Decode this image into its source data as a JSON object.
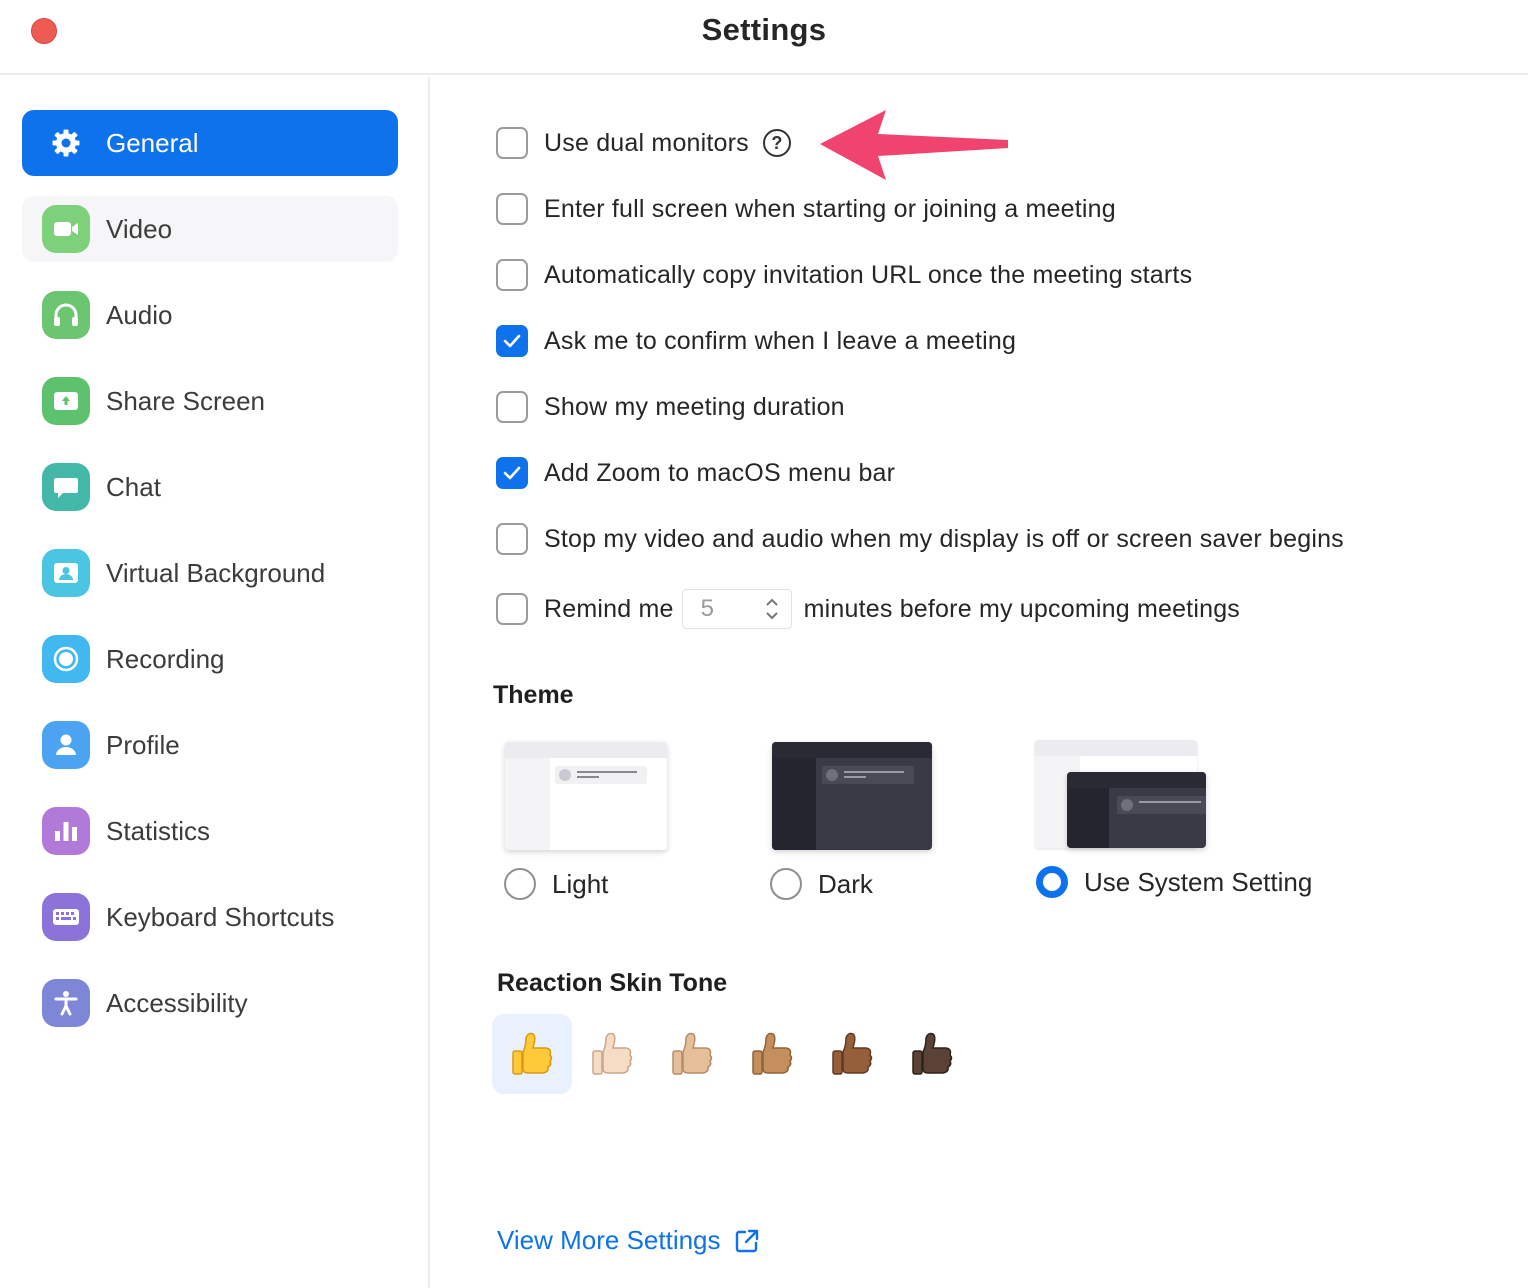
{
  "window": {
    "title": "Settings"
  },
  "sidebar": {
    "items": [
      {
        "label": "General",
        "icon": "gear-icon",
        "color": "#0e72ed",
        "state": "active"
      },
      {
        "label": "Video",
        "icon": "video-camera-icon",
        "color": "#7ed07a",
        "state": "hover"
      },
      {
        "label": "Audio",
        "icon": "headphones-icon",
        "color": "#6cc570",
        "state": ""
      },
      {
        "label": "Share Screen",
        "icon": "share-screen-icon",
        "color": "#5cc26e",
        "state": ""
      },
      {
        "label": "Chat",
        "icon": "chat-bubble-icon",
        "color": "#43b8a8",
        "state": ""
      },
      {
        "label": "Virtual Background",
        "icon": "virtual-background-icon",
        "color": "#4ac6e3",
        "state": ""
      },
      {
        "label": "Recording",
        "icon": "recording-icon",
        "color": "#41b8f0",
        "state": ""
      },
      {
        "label": "Profile",
        "icon": "person-icon",
        "color": "#4ca3f2",
        "state": ""
      },
      {
        "label": "Statistics",
        "icon": "bar-chart-icon",
        "color": "#b27ad8",
        "state": ""
      },
      {
        "label": "Keyboard Shortcuts",
        "icon": "keyboard-icon",
        "color": "#8b73d9",
        "state": ""
      },
      {
        "label": "Accessibility",
        "icon": "accessibility-icon",
        "color": "#7e86d8",
        "state": ""
      }
    ]
  },
  "general": {
    "options": [
      {
        "label": "Use dual monitors",
        "checked": false,
        "help": true
      },
      {
        "label": "Enter full screen when starting or joining a meeting",
        "checked": false
      },
      {
        "label": "Automatically copy invitation URL once the meeting starts",
        "checked": false
      },
      {
        "label": "Ask me to confirm when I leave a meeting",
        "checked": true
      },
      {
        "label": "Show my meeting duration",
        "checked": false
      },
      {
        "label": "Add Zoom to macOS menu bar",
        "checked": true
      },
      {
        "label": "Stop my video and audio when my display is off or screen saver begins",
        "checked": false
      }
    ],
    "help_icon_glyph": "?",
    "remind": {
      "checked": false,
      "label_before": "Remind me",
      "minutes": "5",
      "label_after": "minutes before my upcoming meetings"
    }
  },
  "theme": {
    "title": "Theme",
    "options": [
      {
        "label": "Light",
        "selected": false
      },
      {
        "label": "Dark",
        "selected": false
      },
      {
        "label": "Use System Setting",
        "selected": true
      }
    ]
  },
  "reaction": {
    "title": "Reaction Skin Tone",
    "tones": [
      {
        "icon": "thumbs-up-icon",
        "color": "#ffc93a",
        "selected": true
      },
      {
        "icon": "thumbs-up-icon",
        "color": "#f7dcc4",
        "selected": false
      },
      {
        "icon": "thumbs-up-icon",
        "color": "#e4bf9a",
        "selected": false
      },
      {
        "icon": "thumbs-up-icon",
        "color": "#c58e5e",
        "selected": false
      },
      {
        "icon": "thumbs-up-icon",
        "color": "#955f3b",
        "selected": false
      },
      {
        "icon": "thumbs-up-icon",
        "color": "#5a4237",
        "selected": false
      }
    ]
  },
  "footer": {
    "more_settings": "View More Settings",
    "icon": "external-link-icon"
  },
  "annotation": {
    "icon": "pointer-arrow-icon",
    "color": "#f0436d"
  },
  "colors": {
    "accent": "#0e72ed",
    "close": "#ed5b53"
  }
}
